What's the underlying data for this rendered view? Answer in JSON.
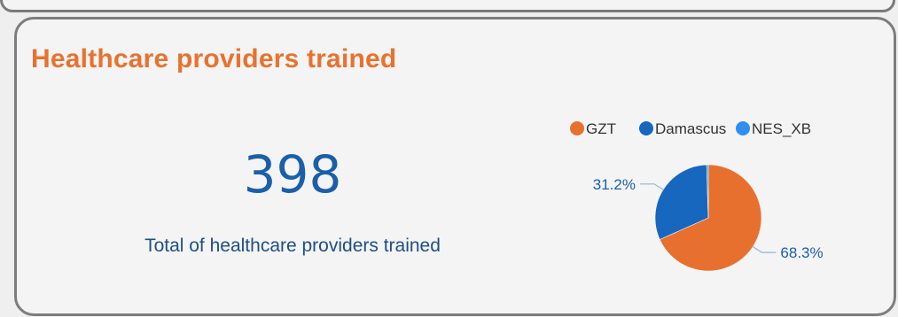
{
  "card": {
    "title": "Healthcare providers trained"
  },
  "kpi": {
    "value": "398",
    "label": "Total of healthcare providers trained"
  },
  "chart_data": {
    "type": "pie",
    "legend_position": "top",
    "slices": [
      {
        "name": "GZT",
        "percent": 68.3,
        "label": "68.3%",
        "color": "#e8702e"
      },
      {
        "name": "Damascus",
        "percent": 31.2,
        "label": "31.2%",
        "color": "#1667bd"
      },
      {
        "name": "NES_XB",
        "percent": 0.5,
        "label": "",
        "color": "#2f8ff0"
      }
    ]
  }
}
